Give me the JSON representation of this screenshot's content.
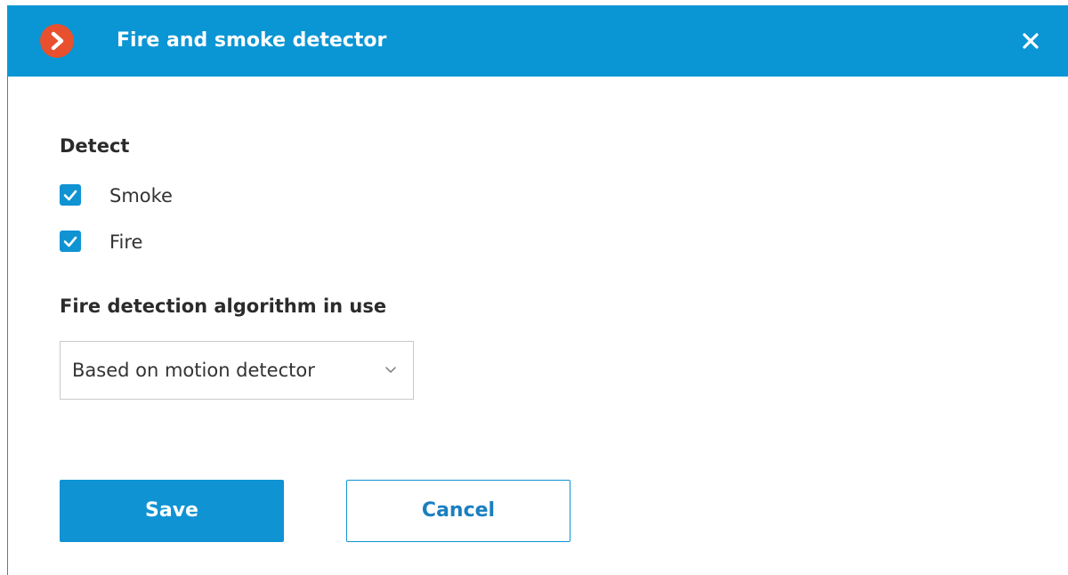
{
  "window": {
    "title": "Fire and smoke detector",
    "app_icon": "chevron-right-icon",
    "close_icon": "close-icon"
  },
  "detect": {
    "label": "Detect",
    "options": [
      {
        "label": "Smoke",
        "checked": true
      },
      {
        "label": "Fire",
        "checked": true
      }
    ]
  },
  "algorithm": {
    "label": "Fire detection algorithm in use",
    "selected": "Based on motion detector",
    "dropdown_icon": "chevron-down-icon"
  },
  "actions": {
    "save_label": "Save",
    "cancel_label": "Cancel"
  },
  "colors": {
    "titlebar": "#0a96d4",
    "accent": "#1093d3",
    "app_icon": "#e8502e"
  }
}
